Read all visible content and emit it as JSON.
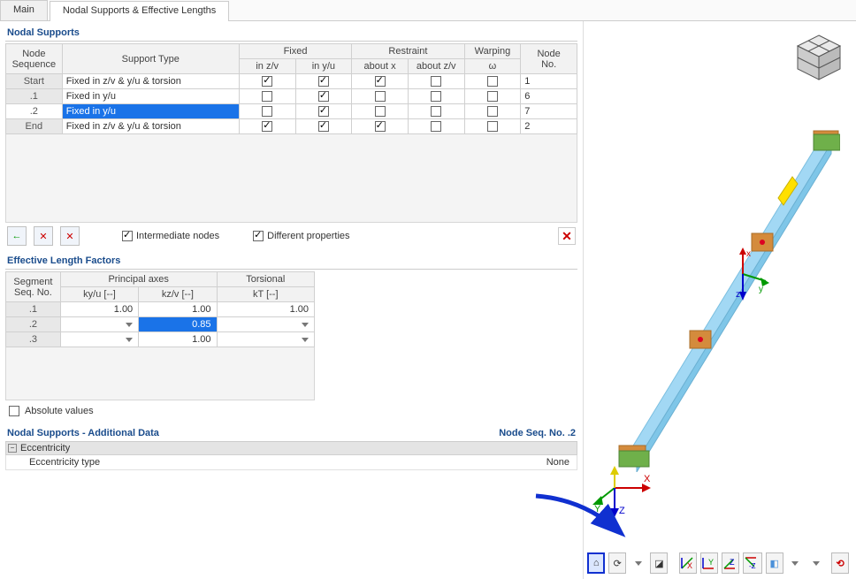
{
  "tabs": [
    "Main",
    "Nodal Supports & Effective Lengths"
  ],
  "active_tab": 1,
  "nodal_supports": {
    "title": "Nodal Supports",
    "headers": {
      "seq": "Node\nSequence",
      "support_type": "Support Type",
      "fixed_group": "Fixed",
      "fixed_zv": "in z/v",
      "fixed_yu": "in y/u",
      "restraint_group": "Restraint",
      "restraint_x": "about x",
      "restraint_zv": "about z/v",
      "warping_group": "Warping",
      "warping_w": "ω",
      "node_no": "Node\nNo."
    },
    "rows": [
      {
        "seq": "Start",
        "type": "Fixed in z/v & y/u & torsion",
        "zv": true,
        "yu": true,
        "rx": true,
        "rzv": false,
        "w": false,
        "node": "1"
      },
      {
        "seq": ".1",
        "type": "Fixed in y/u",
        "zv": false,
        "yu": true,
        "rx": false,
        "rzv": false,
        "w": false,
        "node": "6"
      },
      {
        "seq": ".2",
        "type": "Fixed in y/u",
        "zv": false,
        "yu": true,
        "rx": false,
        "rzv": false,
        "w": false,
        "node": "7",
        "selected": true
      },
      {
        "seq": "End",
        "type": "Fixed in z/v & y/u & torsion",
        "zv": true,
        "yu": true,
        "rx": true,
        "rzv": false,
        "w": false,
        "node": "2"
      }
    ],
    "intermediate_label": "Intermediate nodes",
    "different_label": "Different properties"
  },
  "effective": {
    "title": "Effective Length Factors",
    "headers": {
      "segment": "Segment\nSeq. No.",
      "principal_group": "Principal axes",
      "kyu": "ky/u [--]",
      "kzv": "kz/v [--]",
      "torsional_group": "Torsional",
      "kt": "kT [--]"
    },
    "rows": [
      {
        "seq": ".1",
        "kyu": "1.00",
        "kzv": "1.00",
        "kt": "1.00"
      },
      {
        "seq": ".2",
        "kyu": "",
        "kzv": "0.85",
        "kt": "",
        "selected": true
      },
      {
        "seq": ".3",
        "kyu": "",
        "kzv": "1.00",
        "kt": ""
      }
    ]
  },
  "absolute_label": "Absolute values",
  "additional": {
    "title": "Nodal Supports - Additional Data",
    "context": "Node Seq. No. .2",
    "group": "Eccentricity",
    "row_label": "Eccentricity type",
    "row_value": "None"
  },
  "icons": {
    "back": "←",
    "del1": "✕",
    "del2": "✕",
    "close": "✕"
  },
  "toolbar3d": {
    "btn0": "⌂",
    "btn1": "⟳",
    "btn2": "◪",
    "btn3_x": "X",
    "btn3_y": "Y",
    "btn3_z": "Z",
    "btn3_nz": "-Z",
    "btn4": "◧",
    "refresh": "⟲"
  },
  "axes": {
    "x": "x",
    "y": "y",
    "z": "z",
    "X": "X",
    "Y": "Y",
    "Z": "Z"
  }
}
